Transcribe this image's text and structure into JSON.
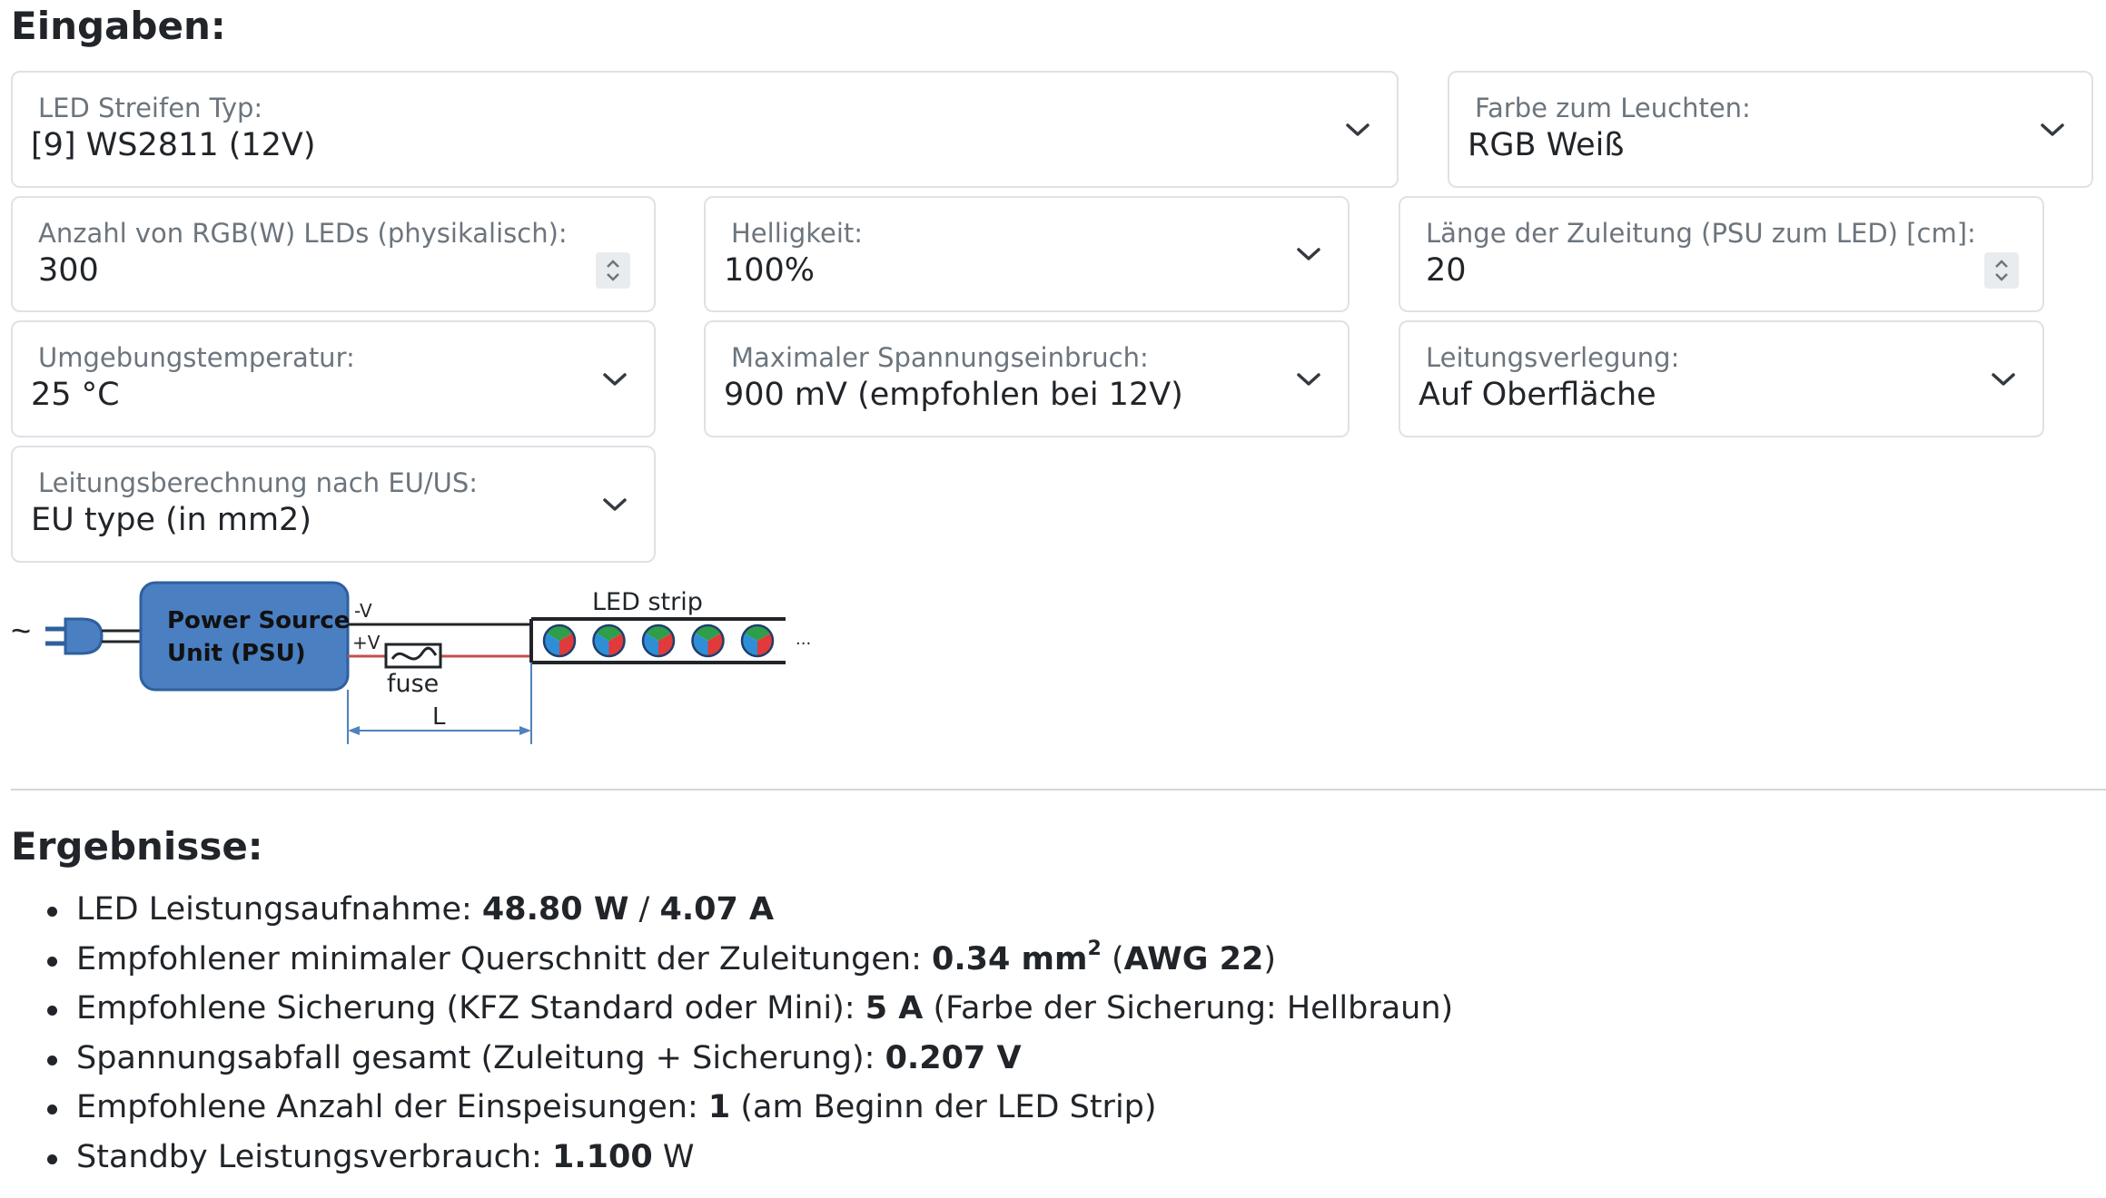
{
  "inputs": {
    "heading": "Eingaben:",
    "led_type": {
      "label": "LED Streifen Typ:",
      "value": "[9] WS2811 (12V)"
    },
    "color": {
      "label": "Farbe zum Leuchten:",
      "value": "RGB Weiß"
    },
    "led_count": {
      "label": "Anzahl von RGB(W) LEDs (physikalisch):",
      "value": "300"
    },
    "brightness": {
      "label": "Helligkeit:",
      "value": "100%"
    },
    "lead_length": {
      "label": "Länge der Zuleitung (PSU zum LED) [cm]:",
      "value": "20"
    },
    "ambient_temp": {
      "label": "Umgebungstemperatur:",
      "value": "25 °C"
    },
    "max_voltage_drop": {
      "label": "Maximaler Spannungseinbruch:",
      "value": "900 mV (empfohlen bei 12V)"
    },
    "cable_routing": {
      "label": "Leitungsverlegung:",
      "value": "Auf Oberfläche"
    },
    "cable_standard": {
      "label": "Leitungsberechnung nach EU/US:",
      "value": "EU type (in mm2)"
    }
  },
  "diagram": {
    "ac_symbol": "~",
    "psu_line1": "Power Source",
    "psu_line2": "Unit (PSU)",
    "neg_label": "-V",
    "pos_label": "+V",
    "fuse_label": "fuse",
    "length_label": "L",
    "strip_label": "LED strip",
    "ellipsis": "...",
    "colors": {
      "psu_fill": "#4a7fc1",
      "psu_border": "#2f5f9e",
      "positive_wire": "#c0504d",
      "dimension": "#4f81bd"
    }
  },
  "results": {
    "heading": "Ergebnisse:",
    "items": [
      {
        "pre": "LED Leistungsaufnahme: ",
        "b1": "48.80 W",
        "mid": " / ",
        "b2": "4.07 A",
        "post": ""
      },
      {
        "pre": "Empfohlener minimaler Querschnitt der Zuleitungen: ",
        "b1": "0.34 mm",
        "sup": "2",
        "mid": " (",
        "b2": "AWG 22",
        "post": ")"
      },
      {
        "pre": "Empfohlene Sicherung (KFZ Standard oder Mini): ",
        "b1": "5 A",
        "mid": " (Farbe der Sicherung: Hellbraun)",
        "b2": "",
        "post": ""
      },
      {
        "pre": "Spannungsabfall gesamt (Zuleitung + Sicherung): ",
        "b1": "0.207 V",
        "mid": "",
        "b2": "",
        "post": ""
      },
      {
        "pre": "Empfohlene Anzahl der Einspeisungen: ",
        "b1": "1",
        "mid": " (am Beginn der LED Strip)",
        "b2": "",
        "post": ""
      },
      {
        "pre": "Standby Leistungsverbrauch: ",
        "b1": "1.100",
        "mid": " W",
        "b2": "",
        "post": ""
      }
    ]
  }
}
